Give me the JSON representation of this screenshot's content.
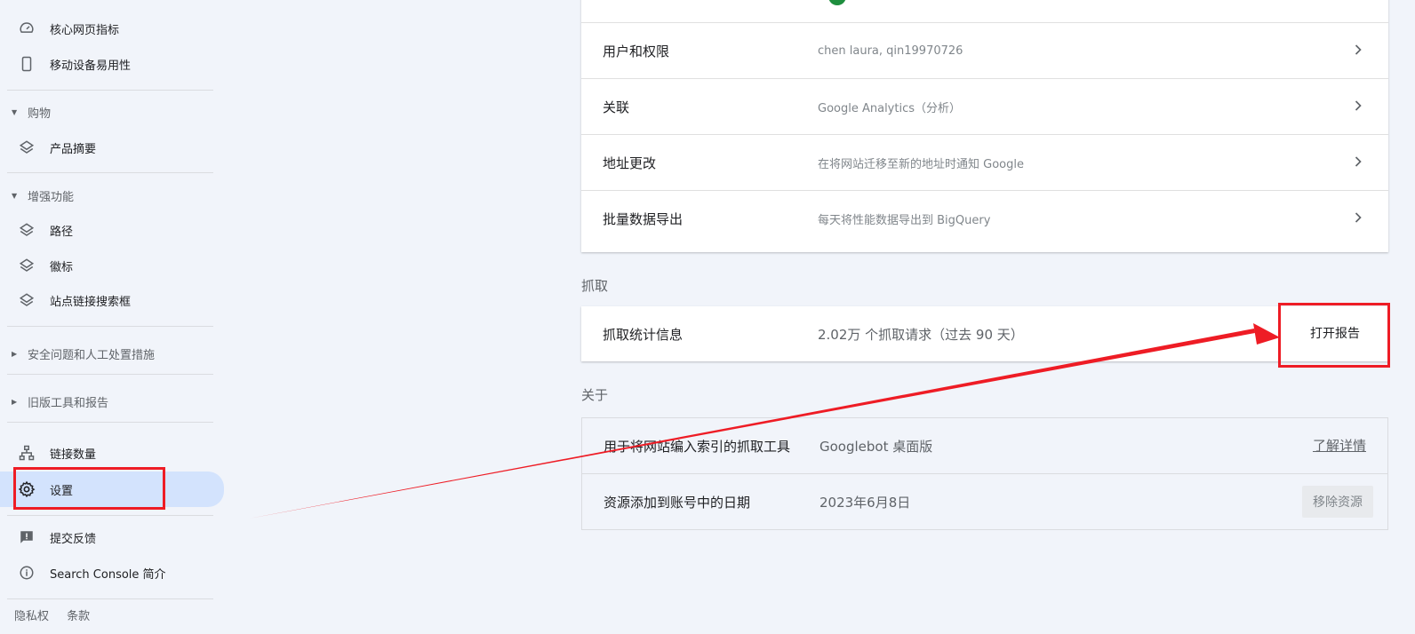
{
  "sidebar": {
    "core_web_vitals": "核心网页指标",
    "mobile_usability": "移动设备易用性",
    "shopping_section": "购物",
    "product_snippets": "产品摘要",
    "enhancements_section": "增强功能",
    "breadcrumbs": "路径",
    "logos": "徽标",
    "sitelinks_searchbox": "站点链接搜索框",
    "security_section": "安全问题和人工处置措施",
    "legacy_section": "旧版工具和报告",
    "links": "链接数量",
    "settings": "设置",
    "feedback": "提交反馈",
    "about_search_console": "Search Console 简介",
    "privacy": "隐私权",
    "terms": "条款"
  },
  "settings_card": {
    "rows": [
      {
        "title": "用户和权限",
        "desc": "chen laura, qin19970726"
      },
      {
        "title": "关联",
        "desc": "Google Analytics（分析）"
      },
      {
        "title": "地址更改",
        "desc": "在将网站迁移至新的地址时通知 Google"
      },
      {
        "title": "批量数据导出",
        "desc": "每天将性能数据导出到 BigQuery"
      }
    ]
  },
  "crawl": {
    "section_label": "抓取",
    "title": "抓取统计信息",
    "desc": "2.02万 个抓取请求（过去 90 天）",
    "open_report": "打开报告"
  },
  "about": {
    "section_label": "关于",
    "crawler_title": "用于将网站编入索引的抓取工具",
    "crawler_value": "Googlebot 桌面版",
    "learn_more": "了解详情",
    "added_title": "资源添加到账号中的日期",
    "added_value": "2023年6月8日",
    "remove_property": "移除资源"
  },
  "colors": {
    "accent_active": "#d3e3fd",
    "annotation_red": "#ee1c25",
    "background": "#f1f4fa"
  }
}
